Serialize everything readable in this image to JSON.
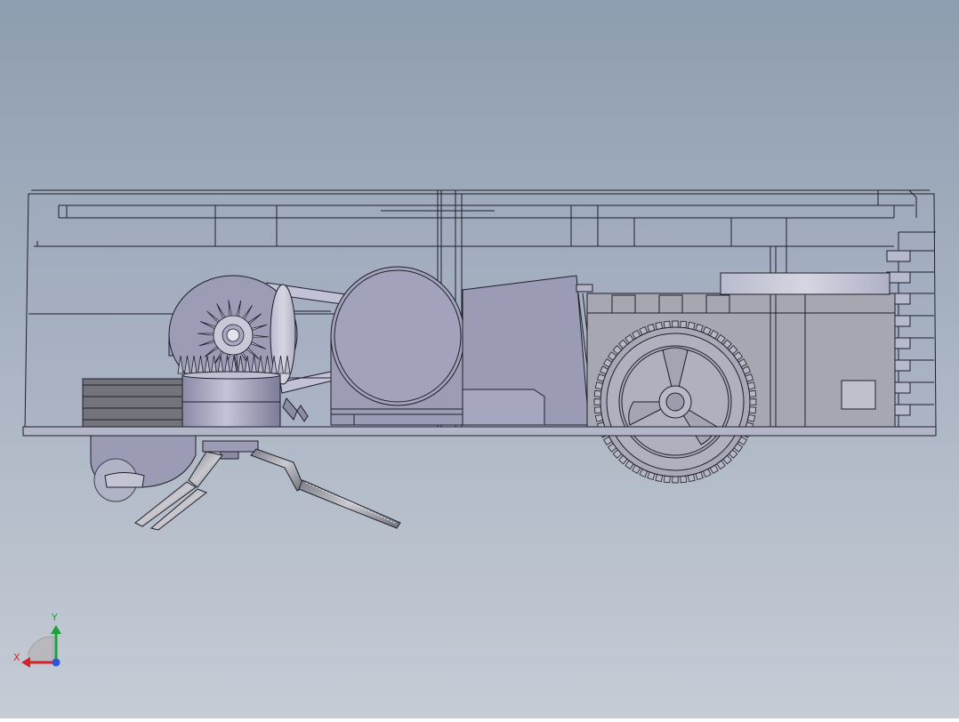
{
  "viewport": {
    "background_top": "#8e9daf",
    "background_bottom": "#c6ccd6"
  },
  "model": {
    "name": "",
    "body_fill": "#9a9ab8",
    "body_light": "#b6b6cf",
    "body_dark": "#6e6e86",
    "edge_color": "#1f1f2b",
    "shell_fill": "#a3acc2"
  },
  "triad": {
    "x_label": "X",
    "y_label": "Y",
    "x_color": "#d4232a",
    "y_color": "#1aa23a",
    "z_color": "#2e54d8"
  }
}
